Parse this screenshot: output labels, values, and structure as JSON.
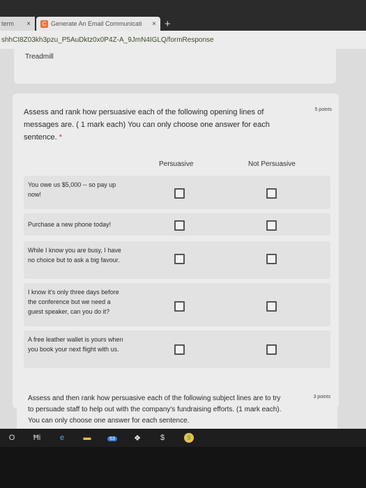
{
  "browser": {
    "tab1_label": "term",
    "tab2_label": "Generate An Email Communicati",
    "tab_close": "×",
    "new_tab": "+",
    "url": "shhCI8Z03kh3pzu_P5AuDktz0x0P4Z-A_9JmN4IGLQ/formResponse"
  },
  "form": {
    "section_title": "Treadmill",
    "question1": {
      "text": "Assess and rank how persuasive each of the following opening lines of messages are. ( 1 mark each) You can only choose one answer for each sentence.",
      "required_mark": "*",
      "points": "5 points",
      "columns": [
        "Persuasive",
        "Not Persuasive"
      ],
      "rows": [
        {
          "label": "You owe us $5,000 -- so pay up now!"
        },
        {
          "label": "Purchase a new phone today!"
        },
        {
          "label": "While I know you are busy, I have no choice but to ask a big favour."
        },
        {
          "label": "I know it's only three days before the conference but we need a guest speaker, can you do it?"
        },
        {
          "label": "A free leather wallet is yours when you book your next flight with us."
        }
      ]
    },
    "question2": {
      "text": "Assess and then rank how persuasive each of the following subject lines are to try to persuade staff to help out with the company's fundraising efforts. (1 mark each). You can only choose one answer for each sentence.",
      "points": "3 points"
    }
  },
  "taskbar": {
    "start": "O",
    "taskview": "Ħi",
    "edge": "e",
    "files": "▬",
    "badge": "63",
    "dropbox": "❖",
    "dollar": "$",
    "chrome": "9"
  }
}
